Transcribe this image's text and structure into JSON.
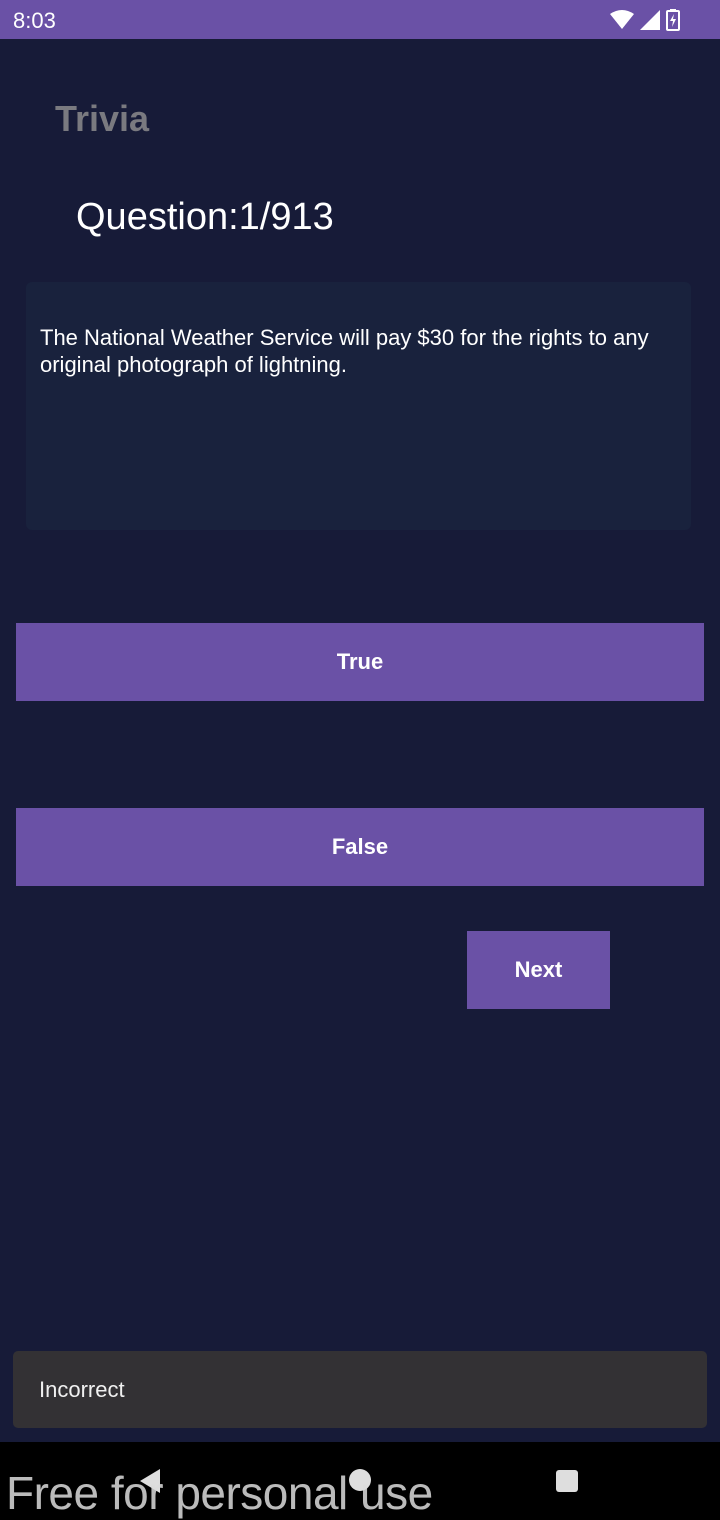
{
  "status_bar": {
    "time": "8:03",
    "icons": [
      "wifi-icon",
      "signal-icon",
      "battery-charging-icon"
    ]
  },
  "app": {
    "title": "Trivia"
  },
  "quiz": {
    "counter": "Question:1/913",
    "question": "The National Weather Service will pay $30 for the rights to any original photograph of lightning."
  },
  "buttons": {
    "true_label": "True",
    "false_label": "False",
    "next_label": "Next"
  },
  "snackbar": {
    "message": "Incorrect"
  },
  "navigation": {
    "icons": [
      "back-icon",
      "home-icon",
      "recents-icon"
    ]
  },
  "watermark": {
    "text": "Free for personal use"
  },
  "colors": {
    "background": "#171b38",
    "accent": "#6a51a6",
    "card": "#19223d",
    "snackbar": "#333134"
  }
}
